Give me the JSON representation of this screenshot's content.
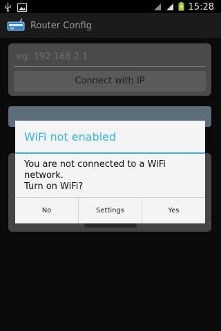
{
  "status_bar": {
    "time": "15:28"
  },
  "app": {
    "title": "Router Config"
  },
  "form": {
    "ip_placeholder": "eg: 192.168.2.1",
    "connect_button": "Connect with IP"
  },
  "dialog": {
    "title": "WiFi not enabled",
    "message_line1": "You are not connected to a WiFi network.",
    "message_line2": "Turn on WiFi?",
    "buttons": {
      "no": "No",
      "settings": "Settings",
      "yes": "Yes"
    }
  },
  "colors": {
    "accent": "#33b5e5"
  }
}
